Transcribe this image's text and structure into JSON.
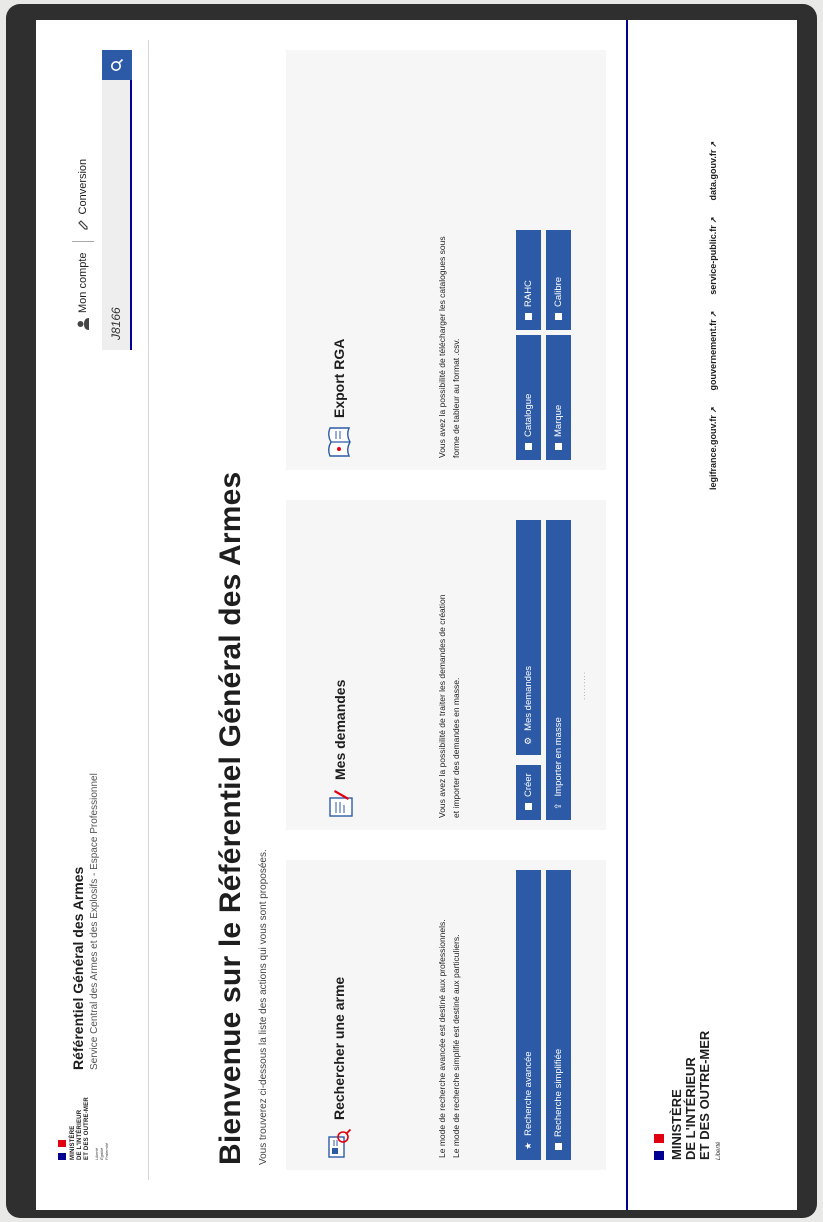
{
  "header": {
    "ministry_logo": {
      "flag_colors": [
        "#000091",
        "#ffffff",
        "#e1000f"
      ],
      "lines": [
        "MINISTÈRE",
        "DE L'INTÉRIEUR",
        "ET DES OUTRE-MER"
      ],
      "motto": [
        "Liberté",
        "Égalité",
        "Fraternité"
      ]
    },
    "site_title": "Référentiel Général des Armes",
    "site_subtitle": "Service Central des Armes et des Explosifs - Espace Professionnel",
    "account_icon": "user-icon",
    "account_label": "Mon compte",
    "conversion_icon": "pencil-icon",
    "conversion_label": "Conversion",
    "search": {
      "value": "J8166",
      "icon": "search-icon"
    }
  },
  "hero": {
    "title": "Bienvenue sur le Référentiel Général des Armes",
    "subtitle": "Vous trouverez ci-dessous la liste des actions qui vous sont proposées."
  },
  "cards": {
    "search": {
      "title": "Rechercher une arme",
      "icon": "id-card-search-icon",
      "desc1": "Le mode de recherche avancée est destiné aux professionnels.",
      "desc2": "Le mode de recherche simplifié est destiné aux particuliers.",
      "buttons": [
        {
          "label": "Recherche avancée",
          "icon": "star-icon"
        },
        {
          "label": "Recherche simplifiée",
          "icon": "square-icon"
        }
      ]
    },
    "requests": {
      "title": "Mes demandes",
      "icon": "document-edit-icon",
      "desc1": "Vous avez la possibilité de traiter les demandes de création",
      "desc2": "et importer des demandes en masse.",
      "buttons": [
        {
          "label": "Créer",
          "icon": "square-icon"
        },
        {
          "label": "Mes demandes",
          "icon": "gear-icon"
        },
        {
          "label": "Importer en masse",
          "icon": "upload-icon"
        }
      ],
      "dots": "........."
    },
    "export": {
      "title": "Export RGA",
      "icon": "book-icon",
      "desc1": "Vous avez la possibilité de télécharger les catalogues sous",
      "desc2": "forme de tableur au format .csv.",
      "buttons": [
        {
          "label": "Catalogue",
          "icon": "square-icon"
        },
        {
          "label": "RAHC",
          "icon": "square-icon"
        },
        {
          "label": "Marque",
          "icon": "square-icon"
        },
        {
          "label": "Calibre",
          "icon": "square-icon"
        }
      ]
    }
  },
  "footer": {
    "ministry_lines": [
      "MINISTÈRE",
      "DE L'INTÉRIEUR",
      "ET DES OUTRE-MER"
    ],
    "motto": "Liberté",
    "links": [
      {
        "label": "legifrance.gouv.fr",
        "icon": "external-link-icon"
      },
      {
        "label": "gouvernement.fr",
        "icon": "external-link-icon"
      },
      {
        "label": "service-public.fr",
        "icon": "external-link-icon"
      },
      {
        "label": "data.gouv.fr",
        "icon": "external-link-icon"
      }
    ]
  },
  "colors": {
    "primary_blue": "#2d5aa7",
    "marianne_blue": "#000091",
    "marianne_red": "#e1000f"
  }
}
